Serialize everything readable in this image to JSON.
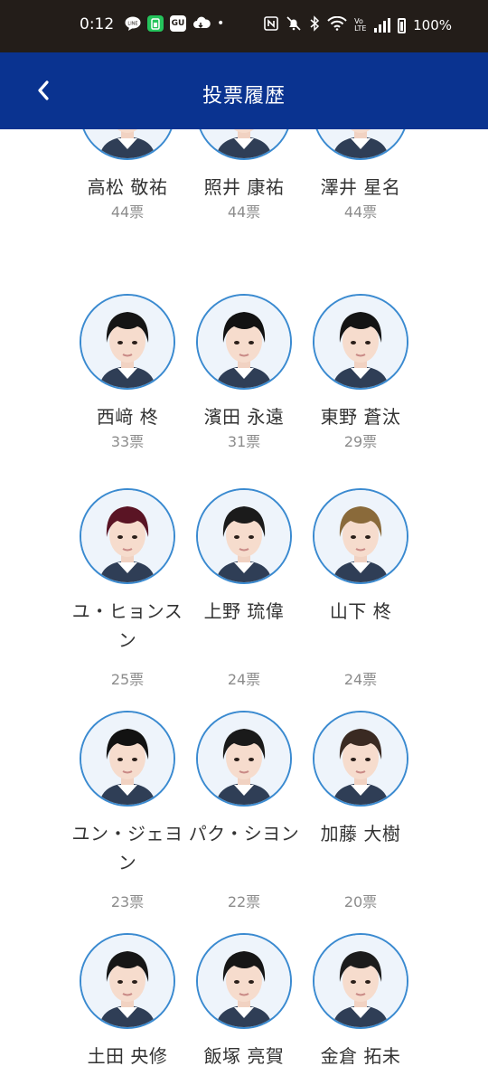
{
  "status_bar": {
    "time": "0:12",
    "battery": "100%",
    "icons": [
      "line-icon",
      "green-app-icon",
      "gu-icon",
      "cloud-icon",
      "dot-icon",
      "nfc-icon",
      "mute-icon",
      "bluetooth-icon",
      "wifi-icon",
      "volte-icon",
      "signal-icon",
      "battery-icon"
    ],
    "gu_label": "GU",
    "volte_label": "Vo LTE",
    "dot": "•"
  },
  "header": {
    "title": "投票履歴",
    "back_icon": "chevron-left-icon",
    "background": "#0a3390"
  },
  "candidates": [
    {
      "name": "高松 敬祐",
      "votes": "44票",
      "hair": "#1a1a1a"
    },
    {
      "name": "照井 康祐",
      "votes": "44票",
      "hair": "#1e1c1b"
    },
    {
      "name": "澤井 星名",
      "votes": "44票",
      "hair": "#2a2220"
    },
    {
      "name": "西﨑 柊",
      "votes": "33票",
      "hair": "#151515"
    },
    {
      "name": "濱田 永遠",
      "votes": "31票",
      "hair": "#121212"
    },
    {
      "name": "東野 蒼汰",
      "votes": "29票",
      "hair": "#141414"
    },
    {
      "name": "ユ・ヒョンスン",
      "votes": "25票",
      "hair": "#5a1424"
    },
    {
      "name": "上野 琉偉",
      "votes": "24票",
      "hair": "#1b1b1b"
    },
    {
      "name": "山下 柊",
      "votes": "24票",
      "hair": "#8a6a3a"
    },
    {
      "name": "ユン・ジェヨン",
      "votes": "23票",
      "hair": "#121212"
    },
    {
      "name": "パク・シヨン",
      "votes": "22票",
      "hair": "#1a1a1a"
    },
    {
      "name": "加藤 大樹",
      "votes": "20票",
      "hair": "#3a2a22"
    },
    {
      "name": "土田 央修",
      "votes": "",
      "hair": "#161616"
    },
    {
      "name": "飯塚 亮賀",
      "votes": "",
      "hair": "#161616"
    },
    {
      "name": "金倉 拓未",
      "votes": "",
      "hair": "#1c1c1c"
    }
  ],
  "colors": {
    "status_bar": "#231d19",
    "avatar_border": "#3a8ad0",
    "name_text": "#333333",
    "votes_text": "#8c8c8c"
  }
}
